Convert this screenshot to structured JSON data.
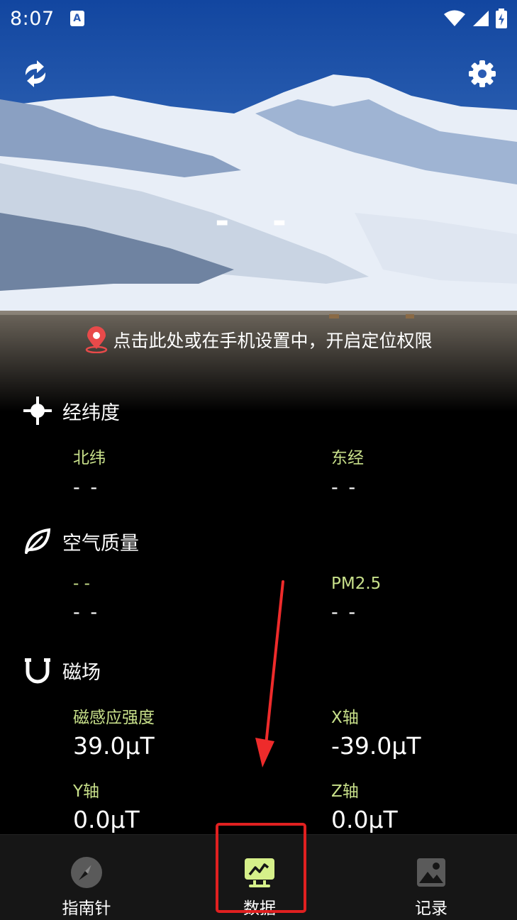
{
  "status_bar": {
    "time": "8:07",
    "app_icon": "A"
  },
  "header": {
    "refresh_icon": "refresh-icon",
    "settings_icon": "gear-icon",
    "heading_value": "- -"
  },
  "location_prompt": {
    "icon": "location-pin-icon",
    "text": "点击此处或在手机设置中，开启定位权限"
  },
  "coordinates": {
    "title": "经纬度",
    "north_label": "北纬",
    "north_value": "- -",
    "east_label": "东经",
    "east_value": "- -"
  },
  "air_quality": {
    "title": "空气质量",
    "left_label": "- -",
    "left_value": "- -",
    "pm_label": "PM2.5",
    "pm_value": "- -"
  },
  "magnetic": {
    "title": "磁场",
    "strength_label": "磁感应强度",
    "strength_value": "39.0μT",
    "x_label": "X轴",
    "x_value": "-39.0μT",
    "y_label": "Y轴",
    "y_value": "0.0μT",
    "z_label": "Z轴",
    "z_value": "0.0μT"
  },
  "bottom_nav": {
    "compass": "指南针",
    "data": "数据",
    "record": "记录"
  },
  "colors": {
    "accent_green": "#c8e08a",
    "highlight_red": "#e02020",
    "nav_bg": "#161616"
  }
}
